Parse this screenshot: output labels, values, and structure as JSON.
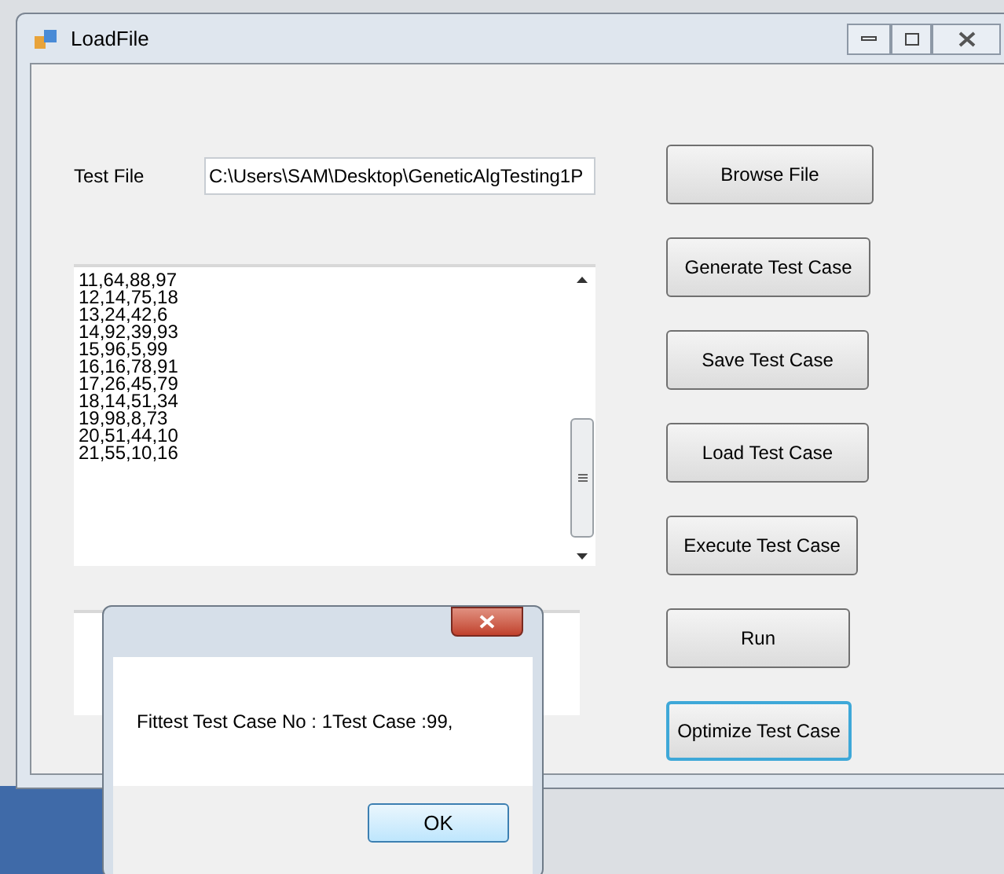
{
  "window": {
    "title": "LoadFile"
  },
  "test_file": {
    "label": "Test File",
    "value": "C:\\Users\\SAM\\Desktop\\GeneticAlgTesting1P"
  },
  "test_cases": [
    "11,64,88,97",
    "12,14,75,18",
    "13,24,42,6",
    "14,92,39,93",
    "15,96,5,99",
    "16,16,78,91",
    "17,26,45,79",
    "18,14,51,34",
    "19,98,8,73",
    "20,51,44,10",
    "21,55,10,16"
  ],
  "buttons": [
    {
      "label": "Browse File",
      "focused": false
    },
    {
      "label": "Generate Test Case",
      "focused": false
    },
    {
      "label": "Save Test Case",
      "focused": false
    },
    {
      "label": "Load Test Case",
      "focused": false
    },
    {
      "label": "Execute Test Case",
      "focused": false
    },
    {
      "label": "Run",
      "focused": false
    },
    {
      "label": "Optimize Test Case",
      "focused": true
    }
  ],
  "dialog": {
    "message": "Fittest Test Case No : 1Test Case :99,",
    "ok_button": "OK"
  }
}
